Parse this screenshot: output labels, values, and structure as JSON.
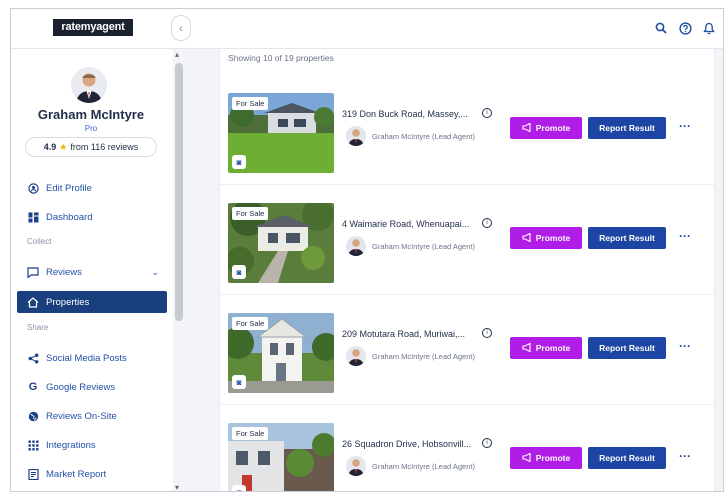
{
  "brand": {
    "logo_text": "ratemyagent"
  },
  "topbar": {
    "collapse_glyph": "‹",
    "icons": [
      "search-icon",
      "help-icon",
      "bell-icon"
    ]
  },
  "profile": {
    "name": "Graham McIntyre",
    "tier": "Pro",
    "rating": "4.9",
    "reviews_text": "from 116 reviews"
  },
  "sidebar": {
    "items": [
      {
        "label": "Edit Profile",
        "icon": "profile-icon"
      },
      {
        "label": "Dashboard",
        "icon": "dashboard-icon"
      }
    ],
    "section_collect": "Collect",
    "collect_items": [
      {
        "label": "Reviews",
        "icon": "message-icon",
        "has_chevron": true
      },
      {
        "label": "Properties",
        "icon": "home-icon",
        "active": true
      }
    ],
    "section_share": "Share",
    "share_items": [
      {
        "label": "Social Media Posts",
        "icon": "share-icon"
      },
      {
        "label": "Google Reviews",
        "icon": "google-icon"
      },
      {
        "label": "Reviews On-Site",
        "icon": "globe-icon"
      },
      {
        "label": "Integrations",
        "icon": "grid-icon"
      },
      {
        "label": "Market Report",
        "icon": "report-icon"
      }
    ]
  },
  "main": {
    "count_text": "Showing 10 of 19 properties",
    "listings": [
      {
        "status": "For Sale",
        "address": "319 Don Buck Road, Massey,...",
        "agent": "Graham McIntyre (Lead Agent)",
        "promote_label": "Promote",
        "report_label": "Report Result",
        "more_label": "···"
      },
      {
        "status": "For Sale",
        "address": "4 Waimarie Road, Whenuapai...",
        "agent": "Graham McIntyre (Lead Agent)",
        "promote_label": "Promote",
        "report_label": "Report Result",
        "more_label": "···"
      },
      {
        "status": "For Sale",
        "address": "209 Motutara Road, Muriwai,...",
        "agent": "Graham McIntyre (Lead Agent)",
        "promote_label": "Promote",
        "report_label": "Report Result",
        "more_label": "···"
      },
      {
        "status": "For Sale",
        "address": "26 Squadron Drive, Hobsonvill...",
        "agent": "Graham McIntyre (Lead Agent)",
        "promote_label": "Promote",
        "report_label": "Report Result",
        "more_label": "···"
      }
    ]
  },
  "colors": {
    "promote": "#b01de6",
    "report": "#1c45a4",
    "nav_active": "#1a3f7e"
  }
}
